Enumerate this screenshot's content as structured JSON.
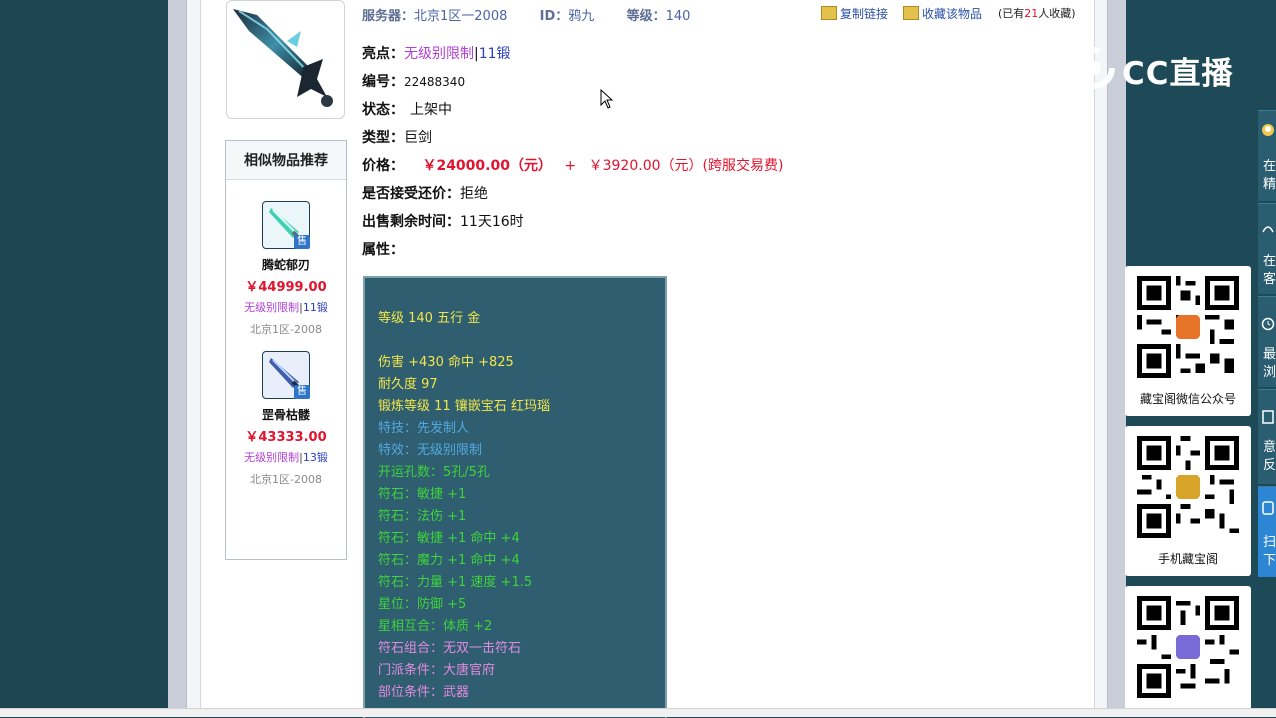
{
  "header": {
    "server_label": "服务器：",
    "server_value": "北京1区一2008",
    "id_label": "ID：",
    "id_value": "鸦九",
    "level_label": "等级：",
    "level_value": "140",
    "copy_link": "复制链接",
    "favorite": "收藏该物品",
    "fav_prefix": "(已有",
    "fav_count": "21",
    "fav_suffix": "人收藏)"
  },
  "info": {
    "highlight_label": "亮点：",
    "highlight_tag": "无级别限制",
    "highlight_sep": "|",
    "highlight_forge": "11锻",
    "serial_label": "编号：",
    "serial_value": "22488340",
    "status_label": "状态：",
    "status_value": "上架中",
    "type_label": "类型：",
    "type_value": "巨剑",
    "price_label": "价格：",
    "price_main": "￥24000.00（元）",
    "price_plus": "+",
    "price_fee": "￥3920.00（元）(跨服交易费)",
    "bargain_label": "是否接受还价：",
    "bargain_value": "拒绝",
    "remaining_label": "出售剩余时间：",
    "remaining_value": "11天16时",
    "attr_label": "属性："
  },
  "attributes": [
    {
      "text": "等级 140 五行 金",
      "color": "#f2e64a"
    },
    {
      "text": "伤害 +430 命中 +825",
      "color": "#f2e64a"
    },
    {
      "text": "耐久度 97",
      "color": "#f2e64a"
    },
    {
      "text": "锻炼等级 11 镶嵌宝石 红玛瑙",
      "color": "#f2e64a"
    },
    {
      "text": "特技：先发制人",
      "color": "#53a8e0"
    },
    {
      "text": "特效：无级别限制",
      "color": "#53a8e0"
    },
    {
      "text": "开运孔数：5孔/5孔",
      "color": "#3fd33c"
    },
    {
      "text": "符石：敏捷 +1",
      "color": "#3fd33c"
    },
    {
      "text": "符石：法伤 +1",
      "color": "#3fd33c"
    },
    {
      "text": "符石：敏捷 +1 命中 +4",
      "color": "#3fd33c"
    },
    {
      "text": "符石：魔力 +1 命中 +4",
      "color": "#3fd33c"
    },
    {
      "text": "符石：力量 +1 速度 +1.5",
      "color": "#3fd33c"
    },
    {
      "text": "星位：防御 +5",
      "color": "#3fd33c"
    },
    {
      "text": "星相互合：体质 +2",
      "color": "#3fd33c"
    },
    {
      "text": "符石组合：无双一击符石",
      "color": "#e28ae0"
    },
    {
      "text": "门派条件：大唐官府",
      "color": "#e28ae0"
    },
    {
      "text": "部位条件：武器",
      "color": "#e28ae0"
    }
  ],
  "recommend": {
    "title": "相似物品推荐",
    "items": [
      {
        "name": "腾蛇郁刃",
        "price": "￥44999.00",
        "tag": "无级别限制",
        "sep": "|",
        "forge": "11锻",
        "server": "北京1区-2008",
        "badge": "售"
      },
      {
        "name": "罡骨枯髅",
        "price": "￥43333.00",
        "tag": "无级别限制",
        "sep": "|",
        "forge": "13锻",
        "server": "北京1区-2008",
        "badge": "售"
      }
    ]
  },
  "overlay": {
    "logo_text": "CC直播",
    "qr_cards": [
      {
        "label": "藏宝阁微信公众号"
      },
      {
        "label": "手机藏宝阁"
      },
      {
        "label": ""
      }
    ],
    "side_tabs": [
      {
        "line1": "在",
        "line2": "精"
      },
      {
        "line1": "在",
        "line2": "客"
      },
      {
        "line1": "最",
        "line2": "浏"
      },
      {
        "line1": "意",
        "line2": "反"
      },
      {
        "line1": "扫",
        "line2": "下"
      }
    ]
  },
  "colors": {
    "page_background": "#1e4a57",
    "attr_box": "#2e5e6f",
    "price_red": "#e2132d",
    "tag_purple": "#b23fd6",
    "forge_blue": "#2a3dbd",
    "side_tab_active": "#2d86d4"
  }
}
